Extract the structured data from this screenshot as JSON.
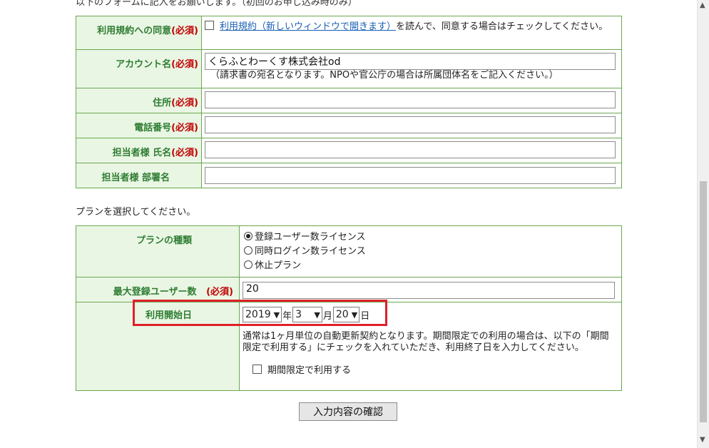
{
  "header": {
    "cut_text": "以下のフォームに記入をお願いします。（初回のお申し込み時のみ）"
  },
  "account_form": {
    "terms": {
      "label": "利用規約への同意",
      "required": "(必須)",
      "link_text": "利用規約（新しいウィンドウで開きます）",
      "text_after": "を読んで、同意する場合はチェックしてください。",
      "checked": false
    },
    "account_name": {
      "label": "アカウント名",
      "required": "(必須)",
      "value": "くらふとわーくす株式会社od",
      "note": "（請求書の宛名となります。NPOや官公庁の場合は所属団体名をご記入ください。）"
    },
    "address": {
      "label": "住所",
      "required": "(必須)",
      "value": ""
    },
    "phone": {
      "label": "電話番号",
      "required": "(必須)",
      "value": ""
    },
    "contact_name": {
      "label": "担当者様 氏名",
      "required": "(必須)",
      "value": ""
    },
    "department": {
      "label": "担当者様 部署名",
      "value": ""
    }
  },
  "plan_prompt": "プランを選択してください。",
  "plan_form": {
    "plan_type": {
      "label": "プランの種類",
      "options": [
        {
          "label": "登録ユーザー数ライセンス",
          "selected": true
        },
        {
          "label": "同時ログイン数ライセンス",
          "selected": false
        },
        {
          "label": "休止プラン",
          "selected": false
        }
      ]
    },
    "max_users": {
      "label": "最大登録ユーザー数",
      "required": "(必須)",
      "value": "20"
    },
    "start_date": {
      "label": "利用開始日",
      "year": "2019",
      "year_unit": "年",
      "month": "3",
      "month_unit": "月",
      "day": "20",
      "day_unit": "日",
      "note": "通常は1ヶ月単位の自動更新契約となります。期間限定での利用の場合は、以下の「期間限定で利用する」にチェックを入れていただき、利用終了日を入力してください。",
      "limited_label": "期間限定で利用する",
      "limited_checked": false
    }
  },
  "submit_label": "入力内容の確認",
  "colors": {
    "label_text": "#2e7d32",
    "required": "#c00000",
    "label_bg": "#eaf6e4",
    "border": "#6aa84f",
    "highlight": "#e0202a"
  },
  "icons": {
    "dropdown": "chevron-down-icon",
    "scroll_up": "arrow-up-icon",
    "scroll_down": "arrow-down-icon"
  }
}
